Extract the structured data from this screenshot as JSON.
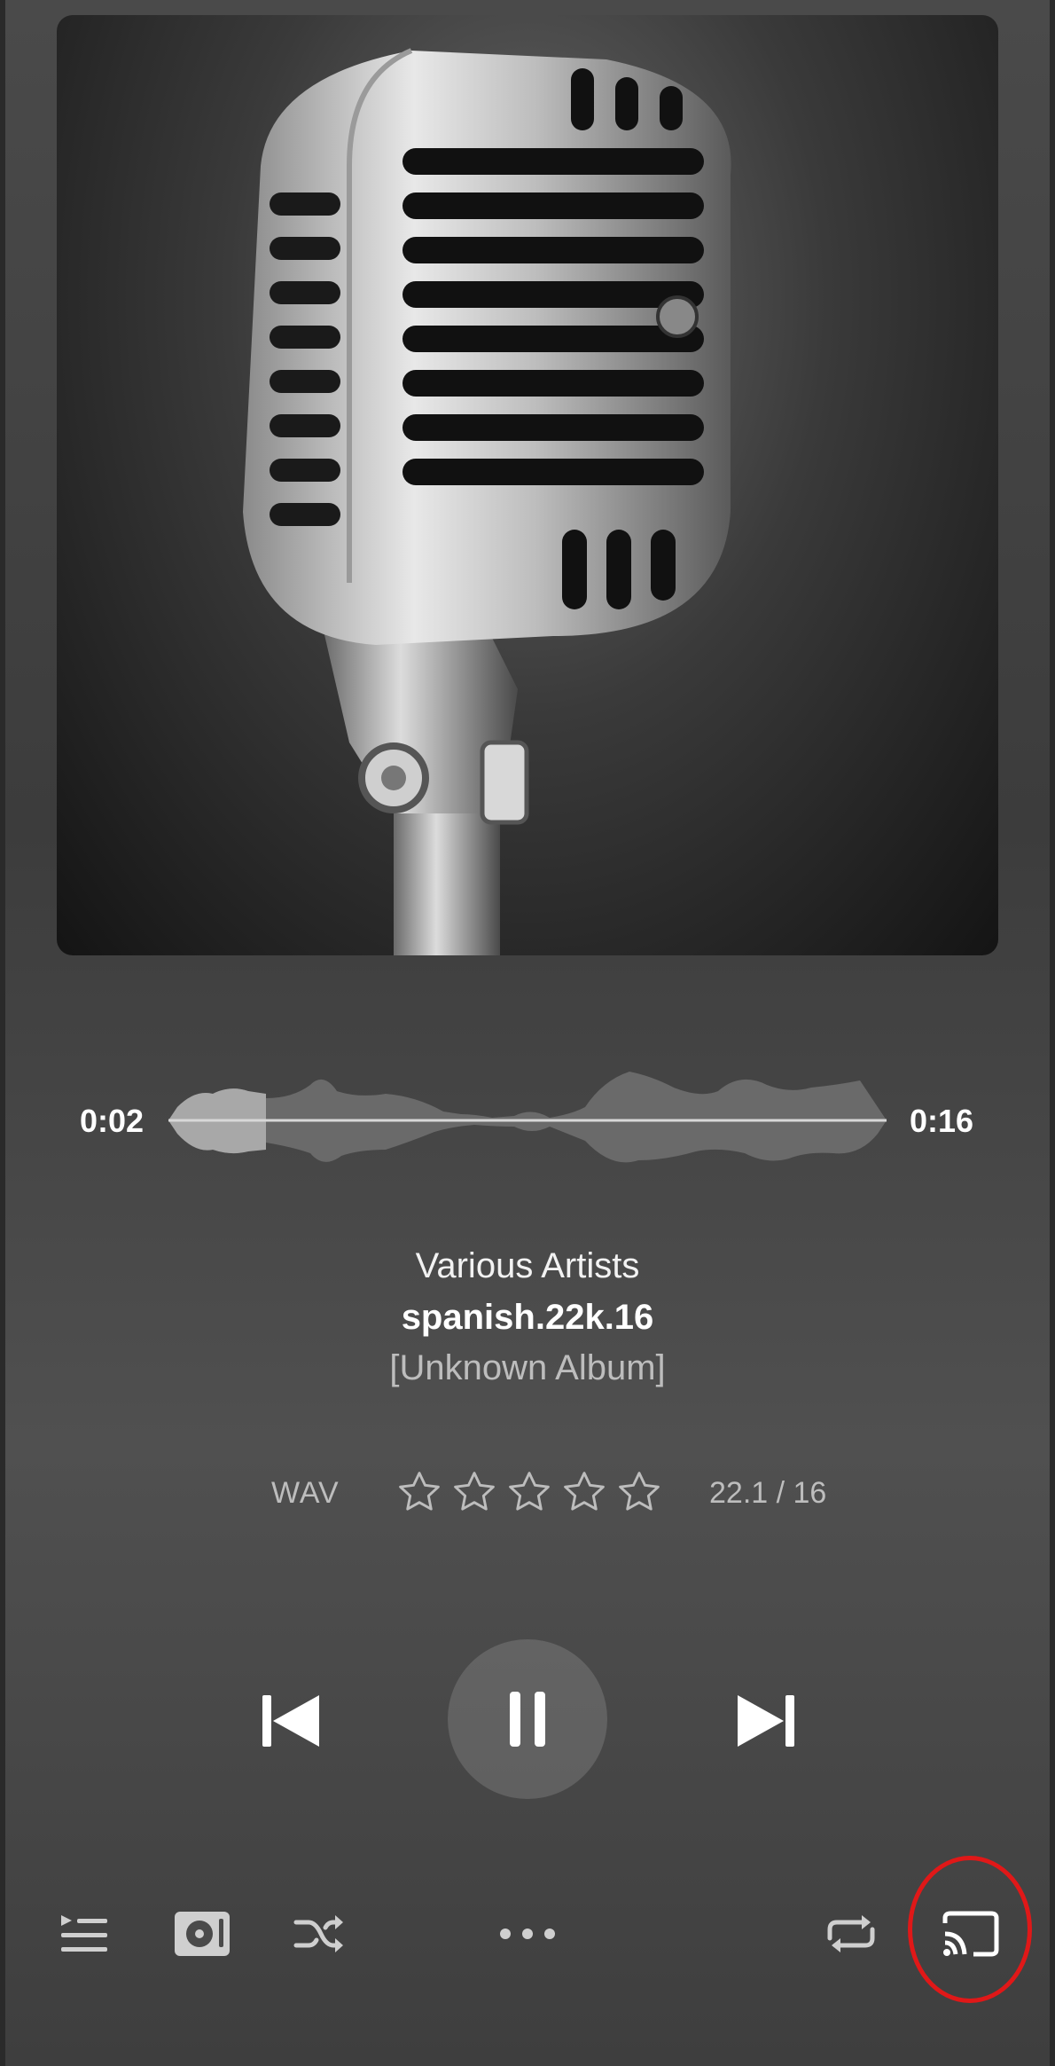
{
  "player": {
    "elapsed": "0:02",
    "duration": "0:16",
    "progress": 0.125
  },
  "track": {
    "artist": "Various Artists",
    "title": "spanish.22k.16",
    "album": "[Unknown Album]"
  },
  "meta": {
    "format": "WAV",
    "rating": 0,
    "rating_max": 5,
    "quality": "22.1 / 16"
  },
  "icons": {
    "album_art": "microphone-artwork",
    "prev": "skip-previous-icon",
    "play_pause": "pause-icon",
    "next": "skip-next-icon",
    "queue": "queue-list-icon",
    "output": "output-device-icon",
    "shuffle": "shuffle-icon",
    "more": "more-horizontal-icon",
    "repeat": "repeat-icon",
    "cast": "cast-icon"
  },
  "colors": {
    "highlight_ring": "#e01818"
  }
}
